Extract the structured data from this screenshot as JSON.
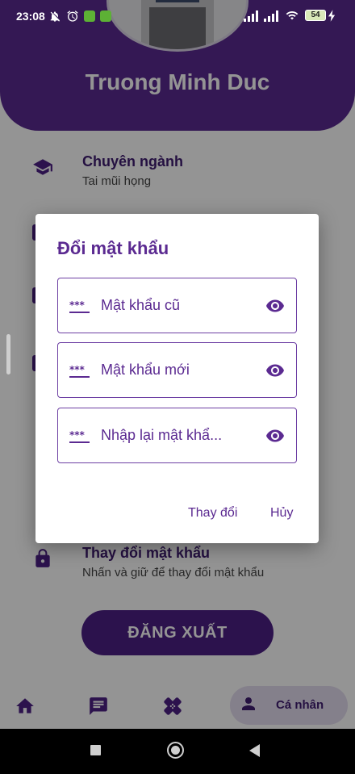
{
  "status_bar": {
    "time": "23:08",
    "battery": "54"
  },
  "profile": {
    "name": "Truong Minh Duc"
  },
  "info_rows": [
    {
      "title": "Chuyên ngành",
      "subtitle": "Tai mũi họng"
    },
    {
      "title": "Thay đổi mật khẩu",
      "subtitle": "Nhấn và giữ để thay đổi mật khẩu"
    }
  ],
  "logout_label": "ĐĂNG XUẤT",
  "bottom_nav": {
    "active_label": "Cá nhân"
  },
  "dialog": {
    "title": "Đổi mật khẩu",
    "fields": [
      {
        "placeholder": "Mật khẩu cũ",
        "value": ""
      },
      {
        "placeholder": "Mật khẩu mới",
        "value": ""
      },
      {
        "placeholder": "Nhập lại mật khẩ...",
        "value": ""
      }
    ],
    "confirm_label": "Thay đổi",
    "cancel_label": "Hủy"
  },
  "colors": {
    "primary": "#5b2a91",
    "primary_dark": "#4c1f86",
    "nav_active_bg": "#e4dcf0"
  },
  "icons": [
    "school-icon",
    "lock-icon",
    "home-icon",
    "chat-icon",
    "bandage-icon",
    "person-icon",
    "key-icon",
    "eye-icon"
  ]
}
